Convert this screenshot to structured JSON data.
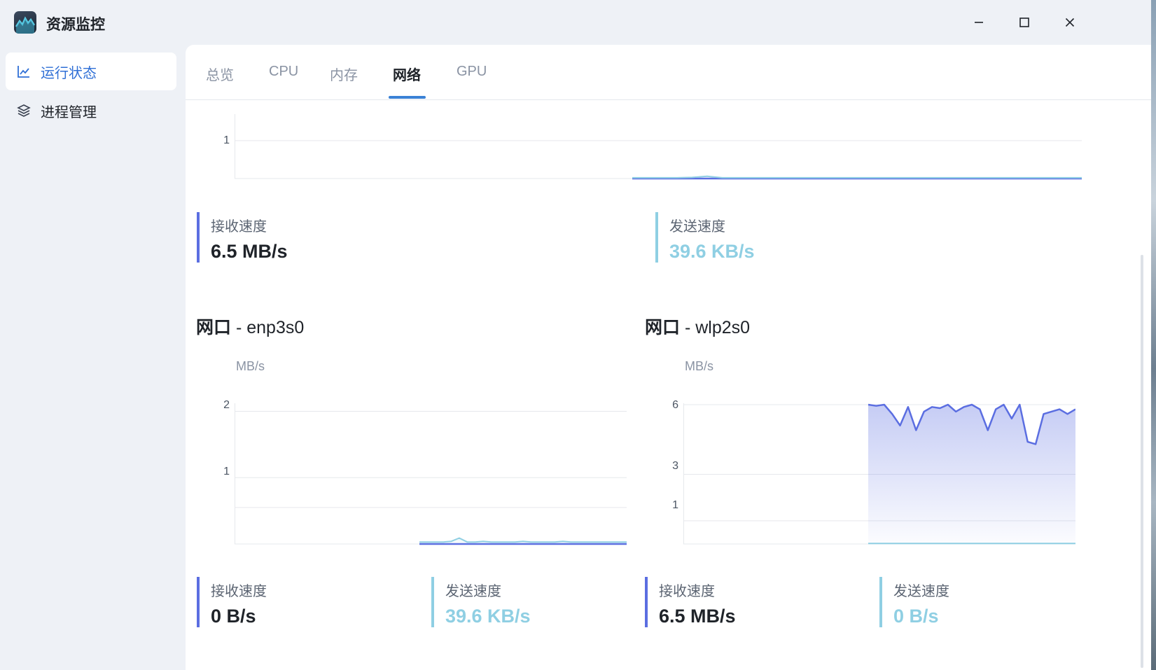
{
  "app": {
    "title": "资源监控"
  },
  "window_controls": {
    "minimize": "minimize-icon",
    "maximize": "maximize-icon",
    "close": "close-icon"
  },
  "sidebar": {
    "items": [
      {
        "label": "运行状态",
        "icon": "line-chart-icon",
        "active": true
      },
      {
        "label": "进程管理",
        "icon": "layers-icon",
        "active": false
      }
    ]
  },
  "tabs": [
    {
      "label": "总览"
    },
    {
      "label": "CPU"
    },
    {
      "label": "内存"
    },
    {
      "label": "网络",
      "active": true
    },
    {
      "label": "GPU"
    }
  ],
  "colors": {
    "receive": "#5b6ee1",
    "send": "#8fcfe3",
    "accent": "#3b82d6"
  },
  "total": {
    "receive_label": "接收速度",
    "receive_value": "6.5 MB/s",
    "send_label": "发送速度",
    "send_value": "39.6 KB/s"
  },
  "interfaces": [
    {
      "title_prefix": "网口",
      "title_name": " - enp3s0",
      "unit": "MB/s",
      "receive_label": "接收速度",
      "receive_value": "0 B/s",
      "send_label": "发送速度",
      "send_value": "39.6 KB/s"
    },
    {
      "title_prefix": "网口",
      "title_name": " - wlp2s0",
      "unit": "MB/s",
      "receive_label": "接收速度",
      "receive_value": "6.5 MB/s",
      "send_label": "发送速度",
      "send_value": "0 B/s"
    }
  ],
  "chart_data": [
    {
      "type": "area",
      "title": "",
      "ylabel": "",
      "xlabel": "",
      "y_ticks": [
        "1"
      ],
      "grid": true,
      "series": [
        {
          "color": "#5b6ee1",
          "values": [
            0,
            0,
            0,
            0,
            0,
            0,
            0,
            0,
            0,
            0,
            0,
            0,
            0,
            0,
            0,
            0,
            0,
            0,
            0,
            0,
            0,
            0,
            0,
            0,
            0,
            0,
            0,
            0,
            0,
            0,
            0
          ]
        },
        {
          "color": "#8fcfe3",
          "values": [
            0.02,
            0.02,
            0.02,
            0.02,
            0.03,
            0.06,
            0.02,
            0.02,
            0.02,
            0.02,
            0.02,
            0.02,
            0.02,
            0.02,
            0.02,
            0.02,
            0.02,
            0.02,
            0.02,
            0.02,
            0.02,
            0.02,
            0.02,
            0.02,
            0.02,
            0.02,
            0.02,
            0.02,
            0.02,
            0.02,
            0.02
          ]
        }
      ]
    },
    {
      "type": "line",
      "title": "",
      "ylabel": "MB/s",
      "xlabel": "",
      "y_ticks": [
        "2",
        "1"
      ],
      "ylim": [
        0,
        2.1
      ],
      "grid": true,
      "series": [
        {
          "color": "#5b6ee1",
          "values": [
            0,
            0,
            0,
            0,
            0,
            0,
            0,
            0,
            0,
            0,
            0,
            0,
            0,
            0,
            0,
            0,
            0,
            0,
            0,
            0,
            0,
            0,
            0,
            0,
            0,
            0,
            0
          ]
        },
        {
          "color": "#8fcfe3",
          "values": [
            0.03,
            0.03,
            0.03,
            0.03,
            0.04,
            0.09,
            0.03,
            0.03,
            0.04,
            0.03,
            0.03,
            0.03,
            0.03,
            0.04,
            0.03,
            0.03,
            0.03,
            0.03,
            0.04,
            0.03,
            0.03,
            0.03,
            0.03,
            0.03,
            0.03,
            0.03,
            0.03
          ]
        }
      ]
    },
    {
      "type": "area",
      "title": "",
      "ylabel": "MB/s",
      "xlabel": "",
      "y_ticks": [
        "6",
        "3",
        "1"
      ],
      "ylim": [
        0,
        6
      ],
      "grid": true,
      "series": [
        {
          "color": "#5b6ee1",
          "values": [
            6.0,
            5.95,
            6.0,
            5.6,
            5.1,
            5.9,
            4.9,
            5.7,
            5.9,
            5.85,
            6.0,
            5.7,
            5.9,
            6.0,
            5.8,
            4.9,
            5.8,
            6.0,
            5.4,
            6.0,
            4.4,
            4.3,
            5.6,
            5.7,
            5.8,
            5.6,
            5.8
          ]
        },
        {
          "color": "#8fcfe3",
          "values": [
            0.02,
            0.02,
            0.02,
            0.02,
            0.02,
            0.02,
            0.02,
            0.02,
            0.02,
            0.02,
            0.02,
            0.02,
            0.02,
            0.02,
            0.02,
            0.02,
            0.02,
            0.02,
            0.02,
            0.02,
            0.02,
            0.02,
            0.02,
            0.02,
            0.02,
            0.02,
            0.02
          ]
        }
      ]
    }
  ]
}
